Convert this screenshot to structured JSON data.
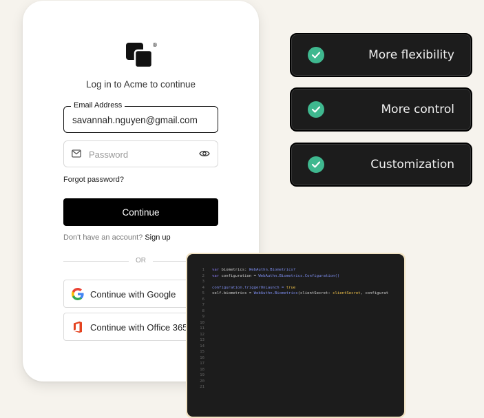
{
  "login": {
    "subtitle": "Log in to Acme to continue",
    "registered_mark": "®",
    "email_label": "Email Address",
    "email_value": "savannah.nguyen@gmail.com",
    "password_placeholder": "Password",
    "forgot_password": "Forgot password?",
    "continue_label": "Continue",
    "no_account_text": "Don't have an account?",
    "signup_label": "Sign up",
    "or_text": "OR",
    "google_label": "Continue with Google",
    "office_label": "Continue with Office 365"
  },
  "features": [
    {
      "label": "More flexibility",
      "icon": "check-circle-icon"
    },
    {
      "label": "More control",
      "icon": "check-circle-icon"
    },
    {
      "label": "Customization",
      "icon": "check-circle-icon"
    }
  ],
  "code": {
    "line_numbers": [
      "1",
      "2",
      "3",
      "4",
      "5",
      "6",
      "7",
      "8",
      "9",
      "10",
      "11",
      "12",
      "13",
      "14",
      "15",
      "16",
      "17",
      "18",
      "19",
      "20",
      "21"
    ],
    "line1": {
      "kw": "var",
      "name": " biometrics: ",
      "type": "WebAuthn.Biometrics?"
    },
    "line2": {
      "kw": "var",
      "name": " configuration = ",
      "type": "WebAuthn.Biometrics.Configuration()"
    },
    "line4": {
      "text": "configuration.triggerOnLaunch = ",
      "kw": "true"
    },
    "line5": {
      "prefix": "self.biometrics = ",
      "type": "WebAuthn.Biometrics",
      "mid": "(clientSecret: ",
      "str": "clientSecret",
      "suffix": ", configurat"
    }
  },
  "colors": {
    "accent_green": "#3fb88f",
    "dark_panel": "#1c1c1c",
    "page_background": "#f6f3ed"
  }
}
